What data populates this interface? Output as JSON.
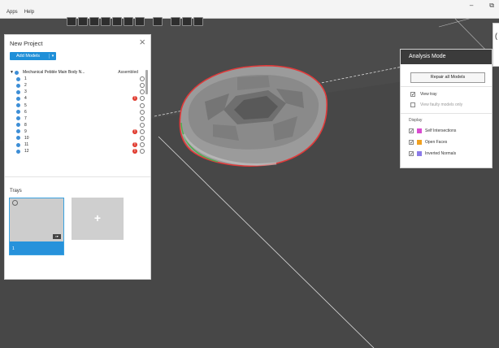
{
  "menubar": {
    "items": [
      "Apps",
      "Help"
    ]
  },
  "window_controls": {
    "minimize": "–",
    "restore": "⧉"
  },
  "toolbar": {
    "icons": [
      "open-icon",
      "save-icon",
      "copy-icon",
      "paste-icon",
      "arrange-icon",
      "grid-icon",
      "rotate-icon",
      "scale-icon",
      "view-front-icon",
      "view-top-icon",
      "view-iso-icon"
    ]
  },
  "project": {
    "title": "New Project",
    "add_models": "Add Models",
    "caret": "▾",
    "assembly": {
      "name": "Mechanical Pebble Main Body N...",
      "status": "Assembled"
    },
    "items": [
      {
        "label": "1",
        "warn": false
      },
      {
        "label": "2",
        "warn": false
      },
      {
        "label": "3",
        "warn": false
      },
      {
        "label": "4",
        "warn": true
      },
      {
        "label": "5",
        "warn": false
      },
      {
        "label": "6",
        "warn": false
      },
      {
        "label": "7",
        "warn": false
      },
      {
        "label": "8",
        "warn": false
      },
      {
        "label": "9",
        "warn": true
      },
      {
        "label": "10",
        "warn": false
      },
      {
        "label": "11",
        "warn": true
      },
      {
        "label": "12",
        "warn": true
      }
    ]
  },
  "trays": {
    "label": "Trays",
    "tray_number": "1",
    "add_symbol": "+"
  },
  "analysis": {
    "title": "Analysis Mode",
    "repair_button": "Repair all Models",
    "view_tray": "View tray",
    "view_faulty": "View faulty models only",
    "display_label": "Display",
    "options": [
      {
        "label": "Self Intersections",
        "color": "#d94bd0"
      },
      {
        "label": "Open Faces",
        "color": "#f0a020"
      },
      {
        "label": "Inverted Normals",
        "color": "#8a7ae8"
      }
    ]
  },
  "side_tab": {
    "text": "("
  }
}
